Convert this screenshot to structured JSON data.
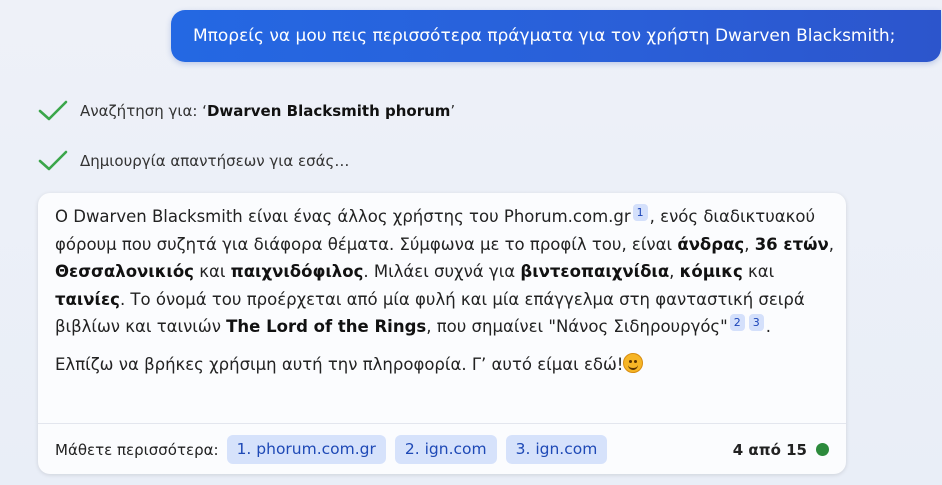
{
  "user_message": "Μπορείς να μου πεις περισσότερα πράγματα για τον χρήστη Dwarven Blacksmith;",
  "steps": [
    {
      "icon": "checkmark-icon",
      "prefix": "Αναζήτηση για: ‘",
      "query": "Dwarven Blacksmith phorum",
      "suffix": "’"
    },
    {
      "icon": "checkmark-icon",
      "text": "Δημιουργία απαντήσεων για εσάς…"
    }
  ],
  "answer": {
    "p1": {
      "t1": "Ο Dwarven Blacksmith είναι ένας άλλος χρήστης του Phorum.com.gr",
      "c1": "1",
      "t2": ", ενός διαδικτυακού φόρουμ που συζητά για διάφορα θέματα. Σύμφωνα με το προφίλ του, είναι ",
      "b1": "άνδρας",
      "t3": ", ",
      "b2": "36 ετών",
      "t4": ", ",
      "b3": "Θεσσαλονικιός",
      "t5": " και ",
      "b4": "παιχνιδόφιλος",
      "t6": ". Μιλάει συχνά για ",
      "b5": "βιντεοπαιχνίδια",
      "t7": ", ",
      "b6": "κόμικς",
      "t8": " και ",
      "b7": "ταινίες",
      "t9": ". Το όνομά του προέρχεται από μία φυλή και μία επάγγελμα στη φανταστική σειρά βιβλίων και ταινιών ",
      "b8": "The Lord of the Rings",
      "t10": ", που σημαίνει \"Νάνος Σιδηρουργός\"",
      "c2": "2",
      "c3": "3",
      "t11": "."
    },
    "p2": {
      "text": "Ελπίζω να βρήκες χρήσιμη αυτή την πληροφορία. Γ’ αυτό είμαι εδώ!",
      "emoji": "smiling-face-icon"
    }
  },
  "learn_more": {
    "label": "Μάθετε περισσότερα:",
    "sources": [
      "1. phorum.com.gr",
      "2. ign.com",
      "3. ign.com"
    ]
  },
  "page_count": "4 από 15",
  "colors": {
    "accent": "#2468e3",
    "chip_bg": "#d6e2fb",
    "chip_text": "#1e49b6",
    "check": "#3aa64a",
    "status_dot": "#2c8a3c"
  }
}
